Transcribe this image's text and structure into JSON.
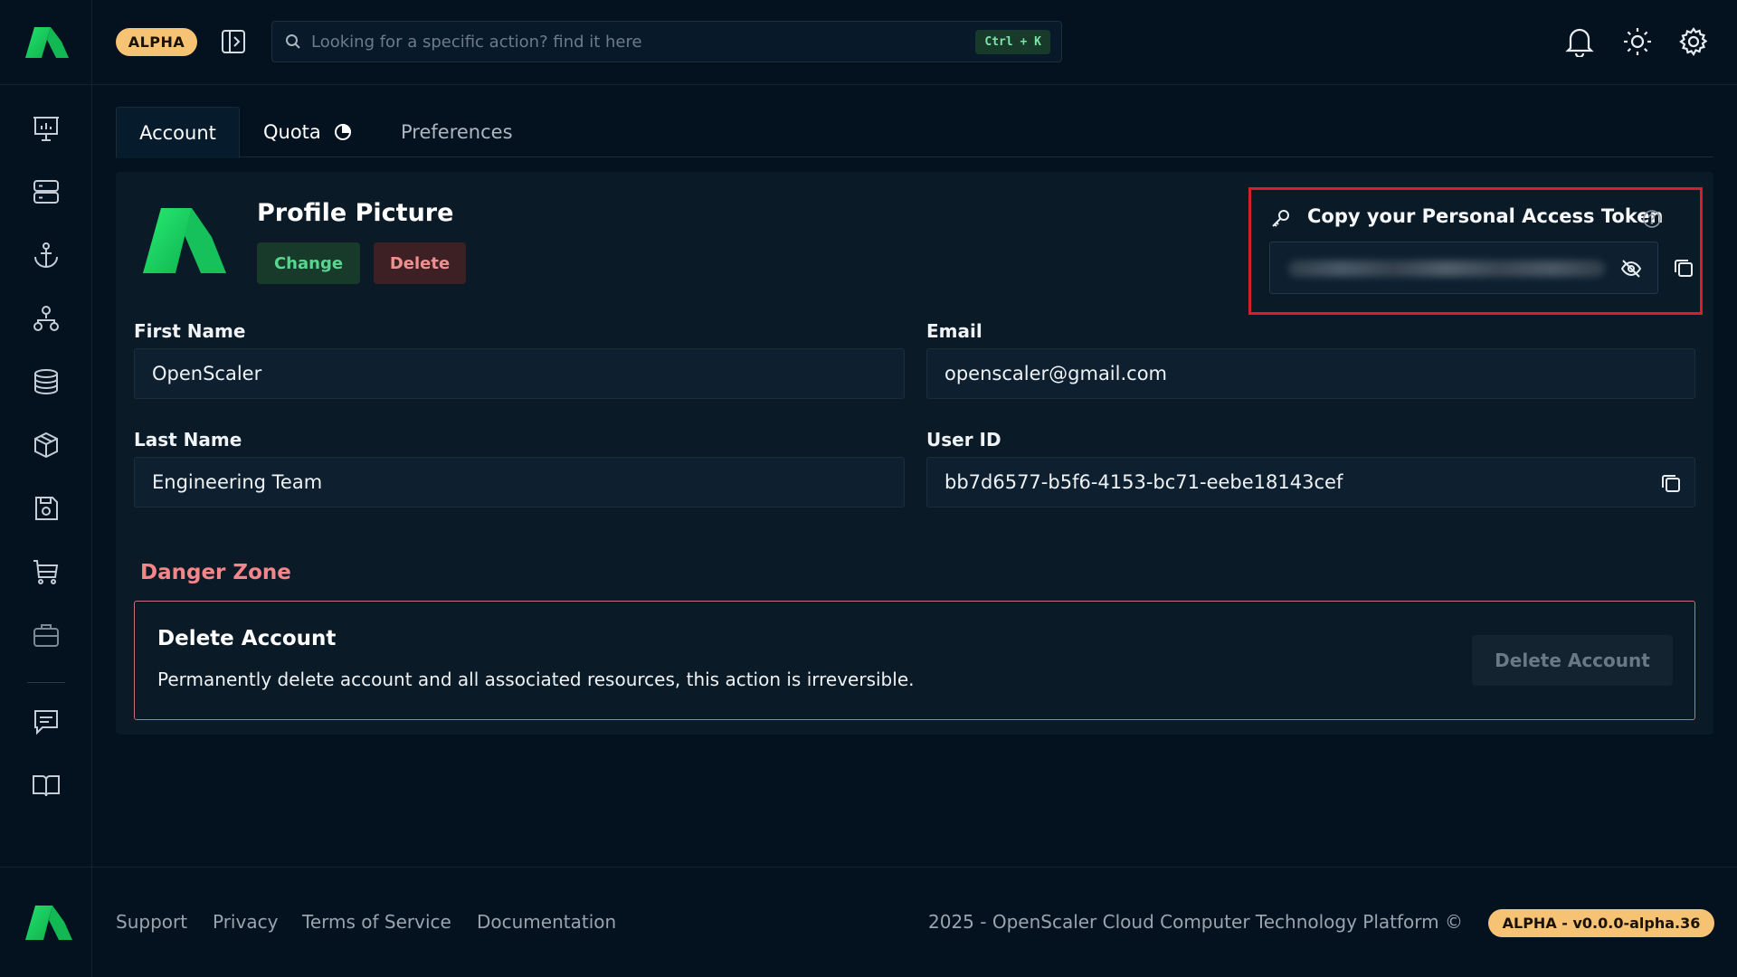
{
  "header": {
    "badge": "ALPHA",
    "search_placeholder": "Looking for a specific action? find it here",
    "search_shortcut": "Ctrl + K"
  },
  "tabs": [
    {
      "label": "Account",
      "active": true
    },
    {
      "label": "Quota",
      "active": false
    },
    {
      "label": "Preferences",
      "active": false
    }
  ],
  "profile": {
    "title": "Profile Picture",
    "change_label": "Change",
    "delete_label": "Delete"
  },
  "token": {
    "title": "Copy your Personal Access Token"
  },
  "fields": {
    "first_name_label": "First Name",
    "first_name": "OpenScaler",
    "email_label": "Email",
    "email": "openscaler@gmail.com",
    "last_name_label": "Last Name",
    "last_name": "Engineering Team",
    "user_id_label": "User ID",
    "user_id": "bb7d6577-b5f6-4153-bc71-eebe18143cef"
  },
  "danger": {
    "title": "Danger Zone",
    "heading": "Delete Account",
    "description": "Permanently delete account and all associated resources, this action is irreversible.",
    "button": "Delete Account"
  },
  "footer": {
    "links": [
      "Support",
      "Privacy",
      "Terms of Service",
      "Documentation"
    ],
    "copyright": "2025 - OpenScaler Cloud Computer Technology Platform ©",
    "version": "ALPHA - v0.0.0-alpha.36"
  },
  "colors": {
    "background": "#041220",
    "accent_green": "#22c55e",
    "alpha_badge": "#f6c274",
    "danger": "#f3868b",
    "highlight_border": "#d61f2a"
  }
}
